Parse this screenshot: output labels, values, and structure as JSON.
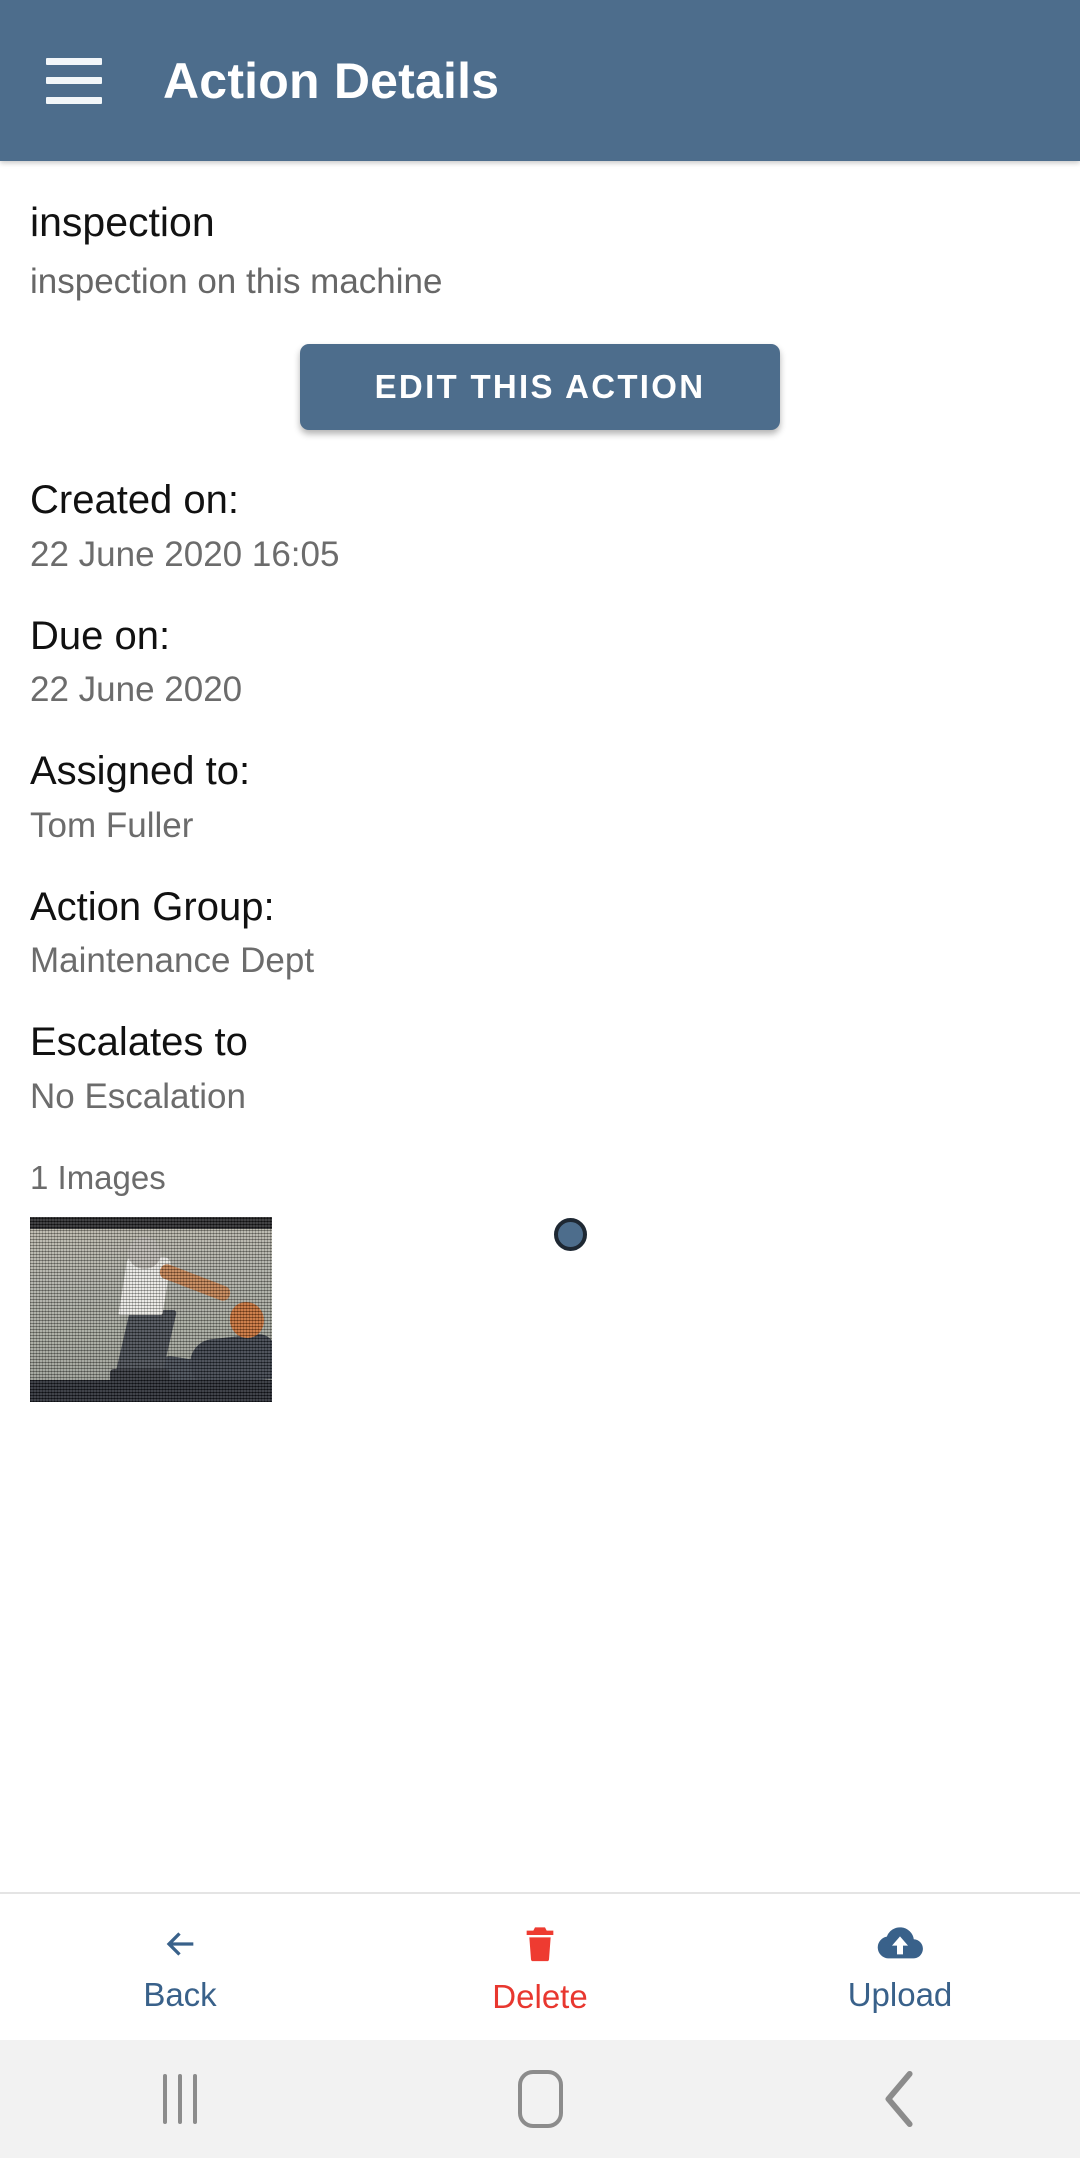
{
  "appbar": {
    "menu_icon": "hamburger-menu-icon",
    "title": "Action Details",
    "background_color": "#4d6d8c"
  },
  "action": {
    "title": "inspection",
    "subtitle": "inspection on this machine",
    "edit_button_label": "EDIT THIS ACTION"
  },
  "fields": [
    {
      "label": "Created on:",
      "value": "22 June 2020 16:05"
    },
    {
      "label": "Due on:",
      "value": "22 June 2020"
    },
    {
      "label": "Assigned to:",
      "value": "Tom Fuller"
    },
    {
      "label": "Action Group:",
      "value": "Maintenance Dept"
    },
    {
      "label": "Escalates to",
      "value": "No Escalation"
    }
  ],
  "gallery": {
    "count_label": "1 Images",
    "thumbnail_alt": "attached-photo-thumbnail",
    "indicator_dot_color": "#4d6d8c"
  },
  "bottombar": {
    "items": [
      {
        "label": "Back",
        "icon": "arrow-left-icon",
        "color": "#39618a"
      },
      {
        "label": "Delete",
        "icon": "trash-icon",
        "color": "#e8372f"
      },
      {
        "label": "Upload",
        "icon": "cloud-upload-icon",
        "color": "#39618a"
      }
    ]
  },
  "navbar": {
    "recents_icon": "recents-icon",
    "home_icon": "home-icon",
    "back_icon": "back-chevron-icon"
  }
}
